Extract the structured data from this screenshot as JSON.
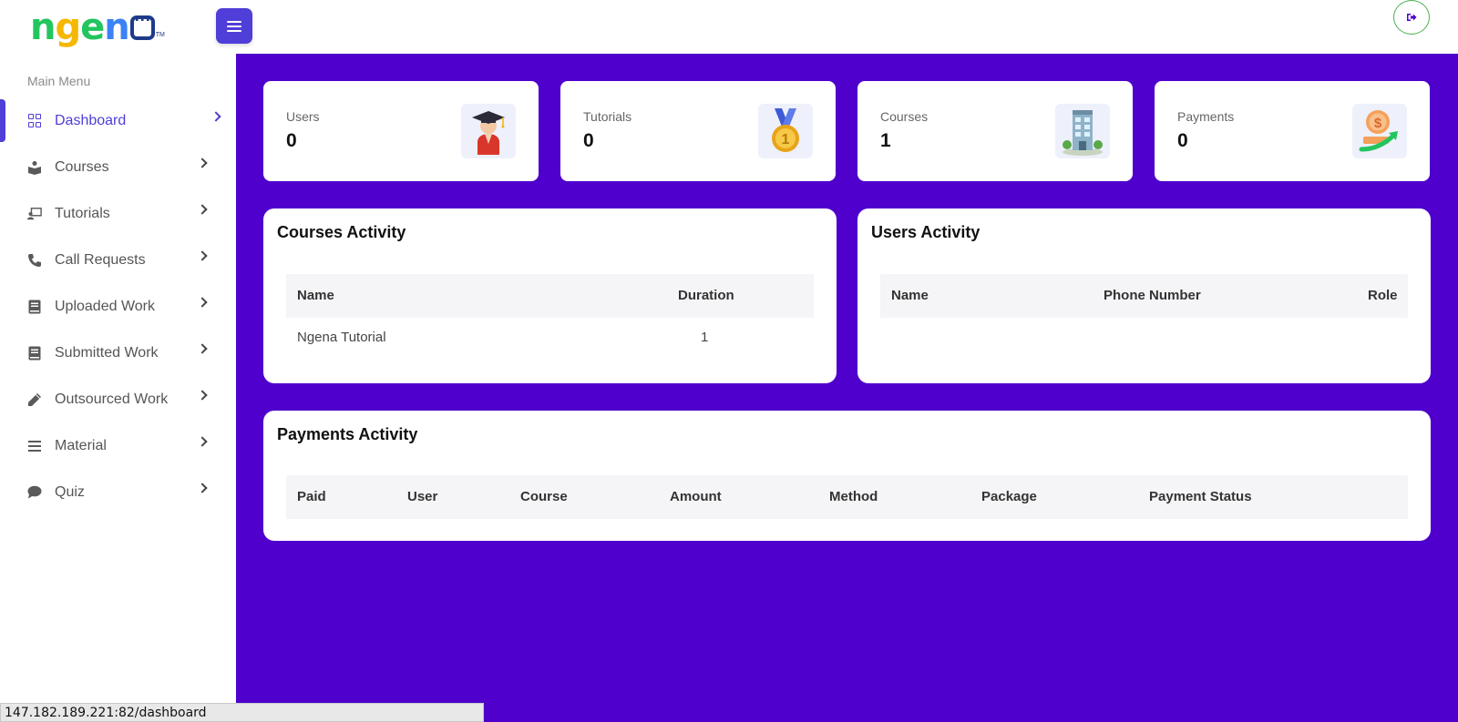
{
  "brand": {
    "name": "ngena",
    "tm": "TM"
  },
  "header": {
    "menu_toggle": "menu",
    "logout": "logout"
  },
  "sidebar": {
    "heading": "Main Menu",
    "items": [
      {
        "label": "Dashboard",
        "icon": "grid-icon",
        "active": true
      },
      {
        "label": "Courses",
        "icon": "book-reader-icon"
      },
      {
        "label": "Tutorials",
        "icon": "chalkboard-teacher-icon"
      },
      {
        "label": "Call Requests",
        "icon": "phone-icon"
      },
      {
        "label": "Uploaded Work",
        "icon": "book-icon"
      },
      {
        "label": "Submitted Work",
        "icon": "book-icon"
      },
      {
        "label": "Outsourced Work",
        "icon": "pencil-icon"
      },
      {
        "label": "Material",
        "icon": "bars-icon"
      },
      {
        "label": "Quiz",
        "icon": "comment-icon"
      }
    ]
  },
  "stats": [
    {
      "label": "Users",
      "value": "0",
      "icon": "graduate-icon"
    },
    {
      "label": "Tutorials",
      "value": "0",
      "icon": "medal-icon"
    },
    {
      "label": "Courses",
      "value": "1",
      "icon": "building-icon"
    },
    {
      "label": "Payments",
      "value": "0",
      "icon": "money-growth-icon"
    }
  ],
  "courses_activity": {
    "title": "Courses Activity",
    "columns": [
      "Name",
      "Duration"
    ],
    "rows": [
      {
        "name": "Ngena Tutorial",
        "duration": "1"
      }
    ]
  },
  "users_activity": {
    "title": "Users Activity",
    "columns": [
      "Name",
      "Phone Number",
      "Role"
    ]
  },
  "payments_activity": {
    "title": "Payments Activity",
    "columns": [
      "Paid",
      "User",
      "Course",
      "Amount",
      "Method",
      "Package",
      "Payment Status"
    ]
  },
  "status_bar": {
    "url": "147.182.189.221:82/dashboard"
  },
  "colors": {
    "primary": "#4f00cc",
    "accent": "#4f3ed8",
    "card_bg": "#ffffff"
  }
}
